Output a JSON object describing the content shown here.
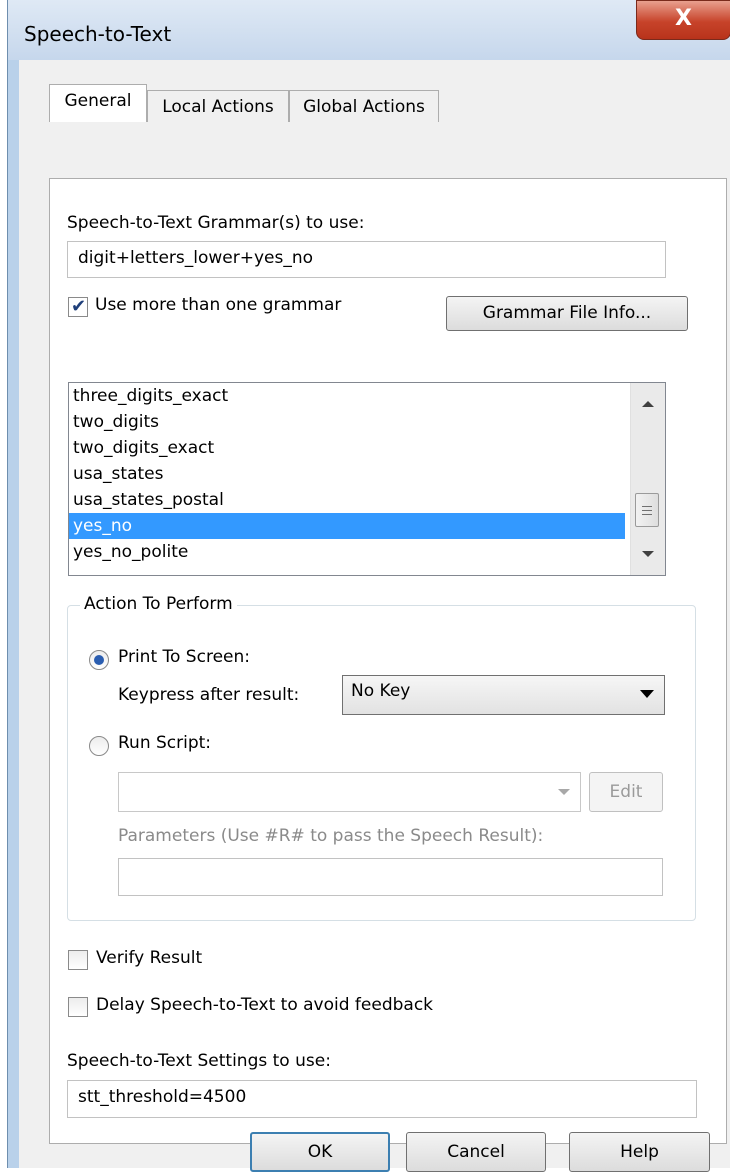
{
  "window": {
    "title": "Speech-to-Text",
    "close_glyph": "X"
  },
  "tabs": [
    {
      "label": "General",
      "active": true
    },
    {
      "label": "Local Actions",
      "active": false
    },
    {
      "label": "Global Actions",
      "active": false
    }
  ],
  "grammar": {
    "label": "Speech-to-Text Grammar(s) to use:",
    "value": "digit+letters_lower+yes_no",
    "multi_checkbox_label": "Use more than one grammar",
    "multi_checked": true,
    "info_button": "Grammar File Info...",
    "list": [
      "three_digits_exact",
      "two_digits",
      "two_digits_exact",
      "usa_states",
      "usa_states_postal",
      "yes_no",
      "yes_no_polite"
    ],
    "selected": "yes_no"
  },
  "action": {
    "group_title": "Action To Perform",
    "print_label": "Print To Screen:",
    "print_selected": true,
    "keypress_label": "Keypress after result:",
    "keypress_value": "No Key",
    "run_script_label": "Run Script:",
    "script_value": "",
    "edit_button": "Edit",
    "params_label": "Parameters (Use #R# to pass the Speech Result):",
    "params_value": ""
  },
  "verify_label": "Verify Result",
  "delay_label": "Delay Speech-to-Text to avoid feedback",
  "settings": {
    "label": "Speech-to-Text Settings to use:",
    "value": "stt_threshold=4500"
  },
  "buttons": {
    "ok": "OK",
    "cancel": "Cancel",
    "help": "Help"
  }
}
